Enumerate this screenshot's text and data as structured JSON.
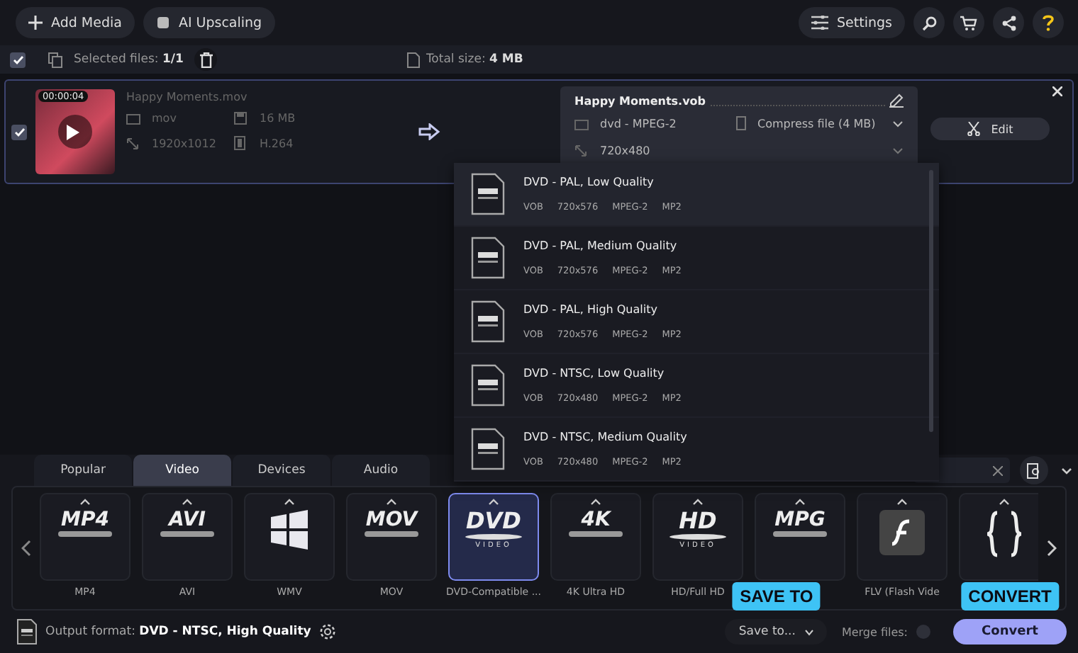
{
  "toolbar": {
    "add_media": "Add Media",
    "ai_upscaling": "AI Upscaling",
    "settings": "Settings"
  },
  "files_bar": {
    "all_checked": true,
    "selected_label": "Selected files:",
    "selected_value": "1/1",
    "total_label": "Total size:",
    "total_value": "4 MB"
  },
  "file": {
    "checked": true,
    "duration": "00:00:04",
    "name": "Happy Moments.mov",
    "format": "mov",
    "size": "16 MB",
    "resolution": "1920x1012",
    "codec": "H.264",
    "output": {
      "name": "Happy Moments.vob",
      "format": "dvd - MPEG-2",
      "compress": "Compress file (4 MB)",
      "resolution": "720x480"
    },
    "edit": "Edit"
  },
  "preset_list": [
    {
      "title": "DVD - PAL, Low Quality",
      "container": "VOB",
      "resolution": "720x576",
      "video": "MPEG-2",
      "audio": "MP2",
      "selected": true
    },
    {
      "title": "DVD - PAL, Medium Quality",
      "container": "VOB",
      "resolution": "720x576",
      "video": "MPEG-2",
      "audio": "MP2",
      "selected": false
    },
    {
      "title": "DVD - PAL, High Quality",
      "container": "VOB",
      "resolution": "720x576",
      "video": "MPEG-2",
      "audio": "MP2",
      "selected": false
    },
    {
      "title": "DVD - NTSC, Low Quality",
      "container": "VOB",
      "resolution": "720x480",
      "video": "MPEG-2",
      "audio": "MP2",
      "selected": false
    },
    {
      "title": "DVD - NTSC, Medium Quality",
      "container": "VOB",
      "resolution": "720x480",
      "video": "MPEG-2",
      "audio": "MP2",
      "selected": false
    }
  ],
  "tabs": [
    {
      "label": "Popular",
      "selected": false
    },
    {
      "label": "Video",
      "selected": true
    },
    {
      "label": "Devices",
      "selected": false
    },
    {
      "label": "Audio",
      "selected": false
    }
  ],
  "formats": [
    {
      "label": "MP4",
      "kind": "text",
      "logo": "MP4",
      "selected": false
    },
    {
      "label": "AVI",
      "kind": "text",
      "logo": "AVI",
      "selected": false
    },
    {
      "label": "WMV",
      "kind": "windows",
      "selected": false
    },
    {
      "label": "MOV",
      "kind": "text",
      "logo": "MOV",
      "selected": false
    },
    {
      "label": "DVD-Compatible ...",
      "kind": "disc",
      "logo": "DVD",
      "sub": "VIDEO",
      "selected": true
    },
    {
      "label": "4K Ultra HD",
      "kind": "text",
      "logo": "4K",
      "selected": false
    },
    {
      "label": "HD/Full HD",
      "kind": "disc",
      "logo": "HD",
      "sub": "VIDEO",
      "selected": false
    },
    {
      "kind": "text",
      "logo": "MPG",
      "selected": false
    },
    {
      "label": "FLV (Flash Vide",
      "kind": "flash",
      "selected": false
    },
    {
      "kind": "braces",
      "selected": false
    }
  ],
  "bottom_bar": {
    "output_label": "Output format:",
    "output_value": "DVD - NTSC, High Quality",
    "save_to": "Save to...",
    "merge_label": "Merge files:",
    "merge_on": false,
    "convert": "Convert"
  },
  "callouts": [
    {
      "text": "SAVE TO"
    },
    {
      "text": "CONVERT"
    }
  ]
}
